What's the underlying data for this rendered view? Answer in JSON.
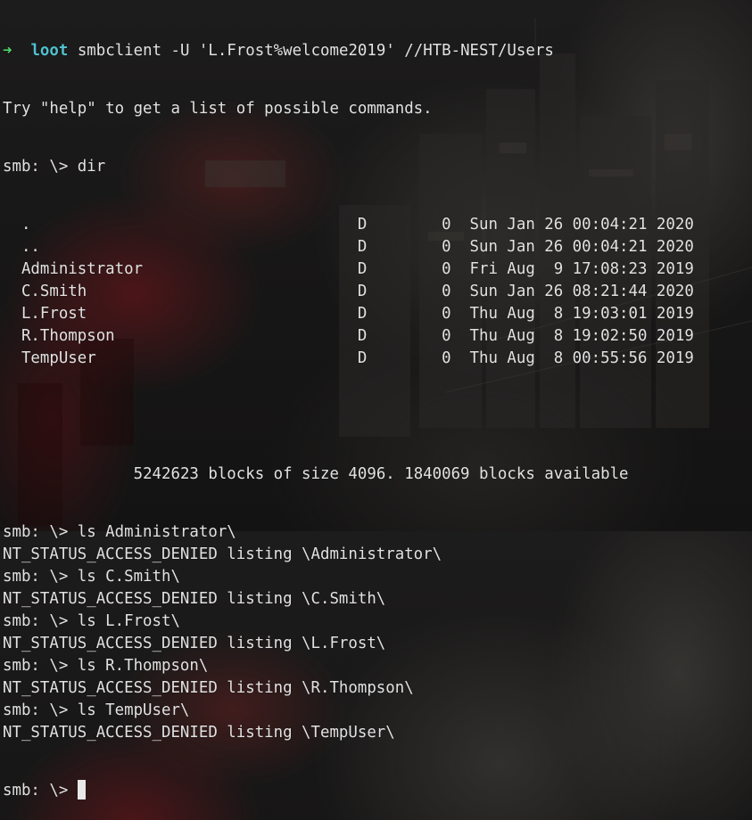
{
  "terminal": {
    "prompt_arrow": "➜",
    "prompt_dir": "loot",
    "command": "smbclient -U 'L.Frost%welcome2019' //HTB-NEST/Users",
    "help_text": "Try \"help\" to get a list of possible commands.",
    "smb_prompt": "smb: \\> ",
    "dir_command": "dir",
    "entries": [
      {
        "name": ".",
        "attr": "D",
        "size": "0",
        "date": "Sun Jan 26 00:04:21 2020"
      },
      {
        "name": "..",
        "attr": "D",
        "size": "0",
        "date": "Sun Jan 26 00:04:21 2020"
      },
      {
        "name": "Administrator",
        "attr": "D",
        "size": "0",
        "date": "Fri Aug  9 17:08:23 2019"
      },
      {
        "name": "C.Smith",
        "attr": "D",
        "size": "0",
        "date": "Sun Jan 26 08:21:44 2020"
      },
      {
        "name": "L.Frost",
        "attr": "D",
        "size": "0",
        "date": "Thu Aug  8 19:03:01 2019"
      },
      {
        "name": "R.Thompson",
        "attr": "D",
        "size": "0",
        "date": "Thu Aug  8 19:02:50 2019"
      },
      {
        "name": "TempUser",
        "attr": "D",
        "size": "0",
        "date": "Thu Aug  8 00:55:56 2019"
      }
    ],
    "blocks_info": "5242623 blocks of size 4096. 1840069 blocks available",
    "ls_commands": [
      {
        "command": "ls Administrator\\",
        "result": "NT_STATUS_ACCESS_DENIED listing \\Administrator\\"
      },
      {
        "command": "ls C.Smith\\",
        "result": "NT_STATUS_ACCESS_DENIED listing \\C.Smith\\"
      },
      {
        "command": "ls L.Frost\\",
        "result": "NT_STATUS_ACCESS_DENIED listing \\L.Frost\\"
      },
      {
        "command": "ls R.Thompson\\",
        "result": "NT_STATUS_ACCESS_DENIED listing \\R.Thompson\\"
      },
      {
        "command": "ls TempUser\\",
        "result": "NT_STATUS_ACCESS_DENIED listing \\TempUser\\"
      }
    ]
  },
  "colors": {
    "prompt_arrow": "#4fd86a",
    "prompt_dir": "#4fc1d0",
    "text": "#e2e2e2",
    "background": "#181717"
  }
}
